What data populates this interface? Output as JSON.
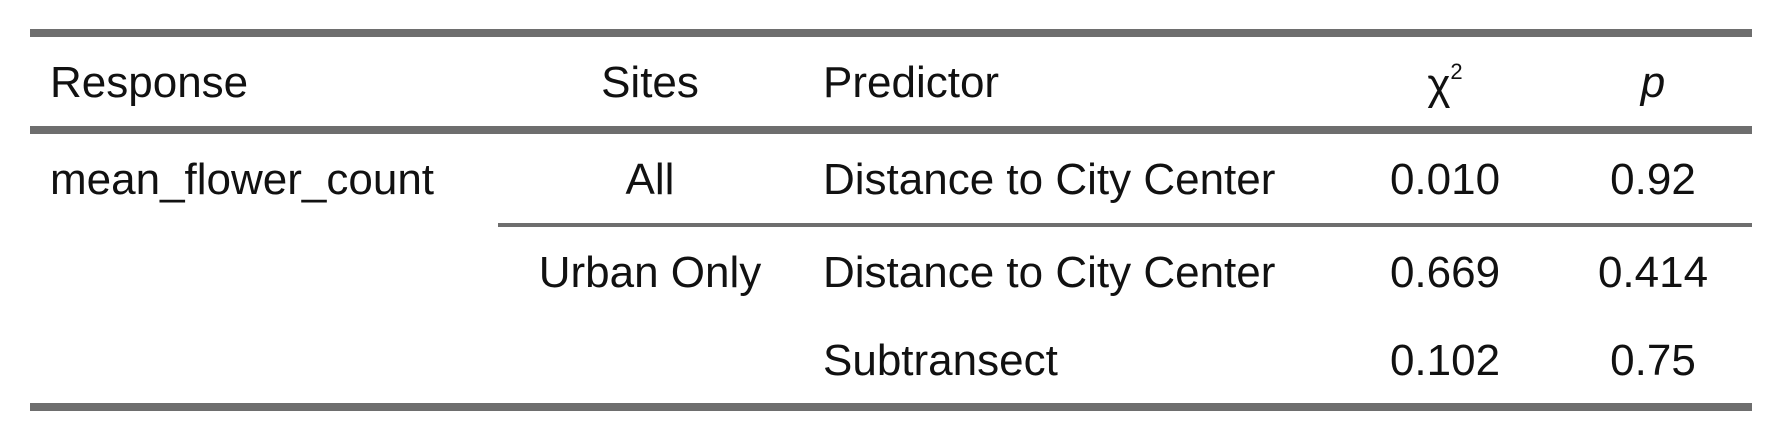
{
  "table": {
    "headers": {
      "response": "Response",
      "sites": "Sites",
      "predictor": "Predictor",
      "chi_base": "χ",
      "chi_sup": "2",
      "p": "p"
    },
    "rows": [
      {
        "response": "mean_flower_count",
        "sites": "All",
        "predictor": "Distance to City Center",
        "chi2": "0.010",
        "p": "0.92"
      },
      {
        "response": "",
        "sites": "Urban Only",
        "predictor": "Distance to City Center",
        "chi2": "0.669",
        "p": "0.414"
      },
      {
        "response": "",
        "sites": "",
        "predictor": "Subtransect",
        "chi2": "0.102",
        "p": "0.75"
      }
    ]
  }
}
